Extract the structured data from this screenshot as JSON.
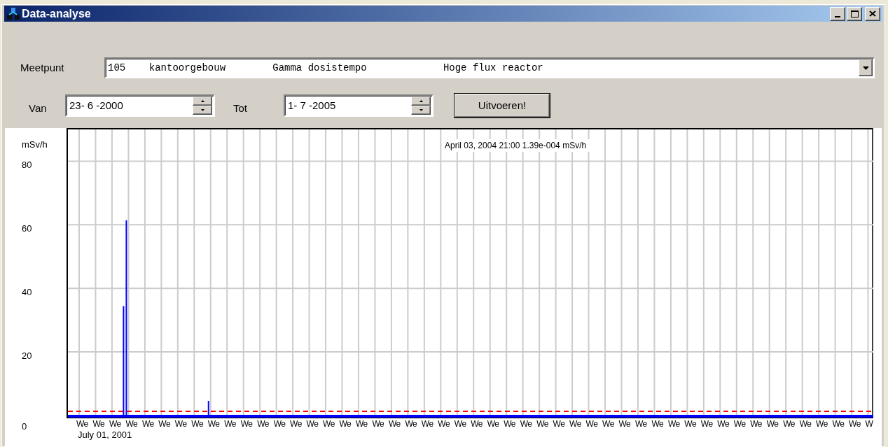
{
  "window": {
    "title": "Data-analyse"
  },
  "meetpunt": {
    "label": "Meetpunt",
    "value": "105    kantoorgebouw        Gamma dosistempo             Hoge flux reactor"
  },
  "van": {
    "label": "Van",
    "value": "23- 6 -2000"
  },
  "tot": {
    "label": "Tot",
    "value": "1- 7 -2005"
  },
  "run_button": "Uitvoeren!",
  "chart": {
    "readout": "April 03, 2004 21:00 1.39e-004 mSv/h",
    "start_date": "July 01, 2001",
    "chart_data": {
      "type": "bar",
      "ylabel": "mSv/h",
      "ylim": [
        0,
        90
      ],
      "yticks": [
        0,
        20,
        40,
        60,
        80
      ],
      "categories": [
        "We",
        "We",
        "We",
        "We",
        "We",
        "We",
        "We",
        "We",
        "We",
        "We",
        "We",
        "We",
        "We",
        "We",
        "We",
        "We",
        "We",
        "We",
        "We",
        "We",
        "We",
        "We",
        "We",
        "We",
        "We",
        "We",
        "We",
        "We",
        "We",
        "We",
        "We",
        "We",
        "We",
        "We",
        "We",
        "We",
        "We",
        "We",
        "We",
        "We",
        "We",
        "We",
        "We",
        "We",
        "We",
        "We",
        "We",
        "We",
        "W"
      ],
      "series": [
        {
          "color": "#0000ff",
          "values": [
            null,
            null,
            null,
            34.4,
            null,
            null,
            null,
            null,
            null,
            null,
            null,
            null,
            null,
            null,
            null,
            null,
            null,
            null,
            null,
            null,
            null,
            null,
            null,
            null,
            null,
            null,
            null,
            null,
            null,
            null,
            null,
            null,
            null,
            null,
            null,
            null,
            null,
            null,
            null,
            null,
            null,
            null,
            null,
            null,
            null,
            null,
            null,
            null,
            null
          ]
        },
        {
          "color": "#0000ff",
          "values": [
            null,
            null,
            null,
            61.4,
            null,
            null,
            null,
            null,
            4.6,
            null,
            null,
            null,
            null,
            null,
            null,
            null,
            null,
            null,
            null,
            null,
            null,
            null,
            null,
            null,
            null,
            null,
            null,
            null,
            null,
            null,
            null,
            null,
            null,
            null,
            null,
            null,
            null,
            null,
            null,
            null,
            null,
            null,
            null,
            null,
            null,
            null,
            null,
            null,
            null
          ]
        }
      ],
      "grid": true,
      "ref_lines": [
        {
          "axis": "y",
          "value": 1.3,
          "color": "#ff0000"
        }
      ]
    }
  }
}
